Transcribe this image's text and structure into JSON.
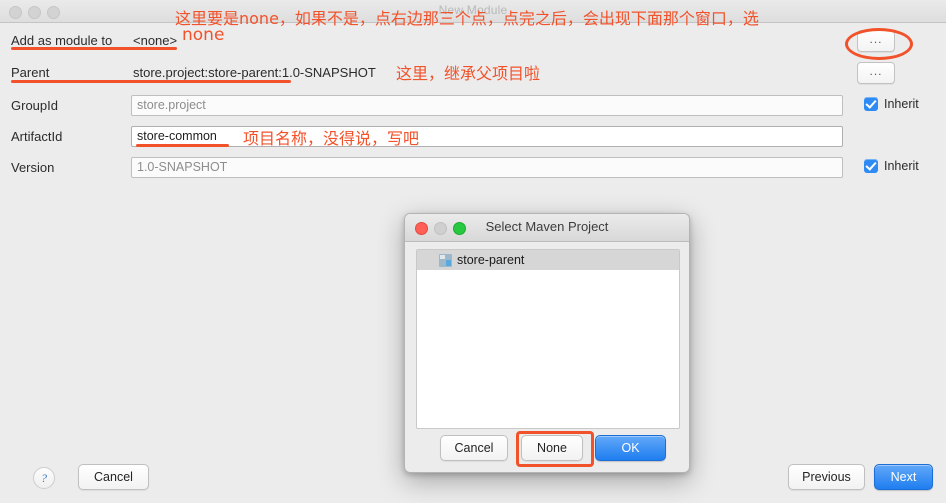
{
  "main_window": {
    "title": "New Module",
    "traffic_lights": [
      "close-icon",
      "minimize-icon",
      "zoom-icon"
    ],
    "fields": {
      "add_as_module_to": {
        "label": "Add as module to",
        "value": "<none>"
      },
      "parent": {
        "label": "Parent",
        "value": "store.project:store-parent:1.0-SNAPSHOT"
      },
      "group_id": {
        "label": "GroupId",
        "value": "store.project",
        "inherit_label": "Inherit",
        "inherit_checked": true
      },
      "artifact_id": {
        "label": "ArtifactId",
        "value": "store-common"
      },
      "version": {
        "label": "Version",
        "value": "1.0-SNAPSHOT",
        "inherit_label": "Inherit",
        "inherit_checked": true
      }
    },
    "browse_buttons": {
      "module_browse_label": "...",
      "parent_browse_label": "..."
    },
    "footer": {
      "help_label": "?",
      "cancel_label": "Cancel",
      "previous_label": "Previous",
      "next_label": "Next"
    }
  },
  "maven_dialog": {
    "title": "Select Maven Project",
    "traffic_lights": [
      "close-icon",
      "minimize-icon",
      "zoom-icon"
    ],
    "list": [
      {
        "label": "store-parent",
        "selected": true,
        "icon": "maven-project-icon"
      }
    ],
    "buttons": {
      "cancel_label": "Cancel",
      "none_label": "None",
      "ok_label": "OK"
    }
  },
  "annotations": {
    "accent_color": "#f2522a",
    "top_note": "这里要是none，如果不是，点右边那三个点，点完之后，会出现下面那个窗口，选",
    "none_note": "none",
    "parent_note": "这里，继承父项目啦",
    "artifact_note": "项目名称，没得说，写吧"
  }
}
